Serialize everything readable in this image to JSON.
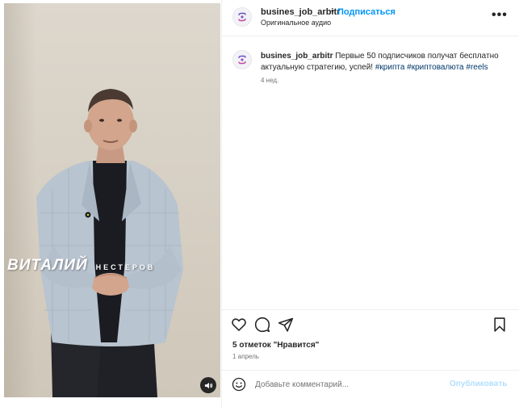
{
  "post": {
    "username": "busines_job_arbitr",
    "separator": "•",
    "follow_label": "Подписаться",
    "audio_label": "Оригинальное аудио",
    "more_label": "•••"
  },
  "caption": {
    "username": "busines_job_arbitr",
    "text": " Первые 50 подписчиков получат бесплатно актуальную стратегию, успей! ",
    "hashtags": [
      "#крипта",
      "#криптовалюта",
      "#reels"
    ],
    "time": "4 нед."
  },
  "video": {
    "name_first": "ВИТАЛИЙ",
    "name_last": "НЕСТЕРОВ"
  },
  "stats": {
    "likes": "5 отметок \"Нравится\"",
    "date": "1 апрель"
  },
  "composer": {
    "placeholder": "Добавьте комментарий...",
    "publish_label": "Опубликовать"
  },
  "colors": {
    "accent": "#0095f6",
    "publish_disabled": "#b2dffc",
    "hashtag": "#00376b",
    "secondary_text": "#737373"
  },
  "icons": {
    "mute": "speaker-icon",
    "like": "heart-icon",
    "comment": "comment-icon",
    "share": "paper-plane-icon",
    "save": "bookmark-icon",
    "emoji": "emoji-icon",
    "more": "more-options-icon"
  }
}
